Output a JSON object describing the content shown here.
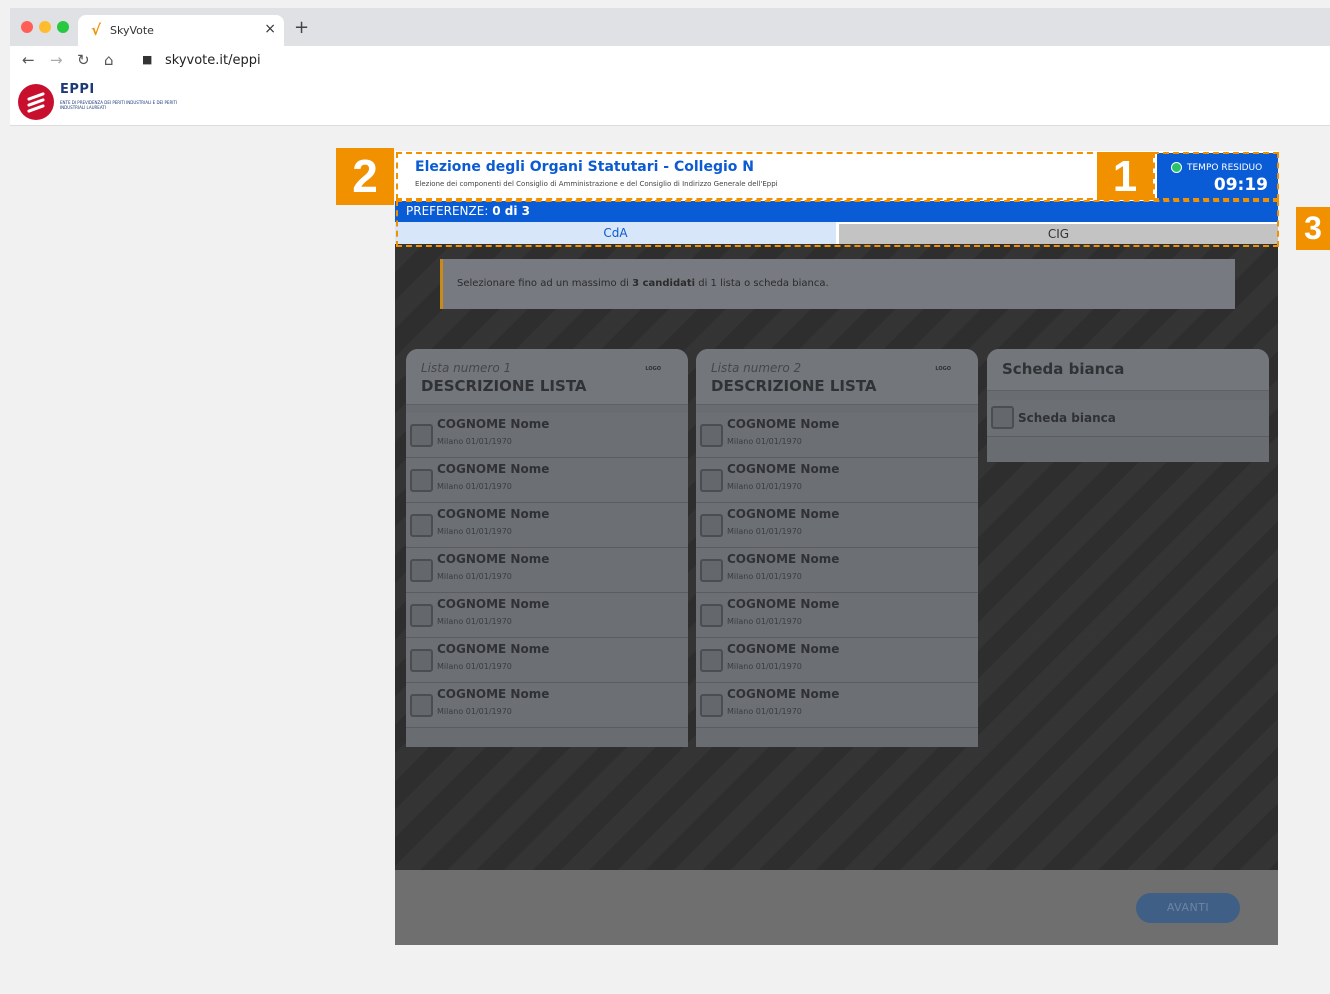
{
  "browser": {
    "tab_title": "SkyVote",
    "tab_close": "×",
    "new_tab": "+",
    "url": "skyvote.it/eppi"
  },
  "site": {
    "logo_name": "EPPI",
    "logo_sub": "ENTE DI PREVIDENZA DEI PERITI INDUSTRIALI E DEI PERITI INDUSTRIALI LAUREATI"
  },
  "header": {
    "title": "Elezione degli Organi Statutari - Collegio N",
    "subtitle": "Elezione dei componenti del Consiglio di Amministrazione e del Consiglio di Indirizzo Generale dell'Eppi"
  },
  "timer": {
    "label": "TEMPO RESIDUO",
    "value": "09:19",
    "status_color": "#29c36a"
  },
  "preferences": {
    "label": "PREFERENZE:",
    "count": "0 di 3"
  },
  "tabs": {
    "cda": "CdA",
    "cig": "CIG"
  },
  "notice": {
    "text_before": "Selezionare fino ad un massimo di ",
    "text_bold": "3 candidati",
    "text_after": " di 1 lista o scheda bianca."
  },
  "lists": [
    {
      "number": "Lista numero 1",
      "description": "DESCRIZIONE LISTA",
      "logo": "LOGO",
      "candidates": [
        {
          "name": "COGNOME Nome",
          "info": "Milano 01/01/1970"
        },
        {
          "name": "COGNOME Nome",
          "info": "Milano 01/01/1970"
        },
        {
          "name": "COGNOME Nome",
          "info": "Milano 01/01/1970"
        },
        {
          "name": "COGNOME Nome",
          "info": "Milano 01/01/1970"
        },
        {
          "name": "COGNOME Nome",
          "info": "Milano 01/01/1970"
        },
        {
          "name": "COGNOME Nome",
          "info": "Milano 01/01/1970"
        },
        {
          "name": "COGNOME Nome",
          "info": "Milano 01/01/1970"
        }
      ]
    },
    {
      "number": "Lista numero 2",
      "description": "DESCRIZIONE LISTA",
      "logo": "LOGO",
      "candidates": [
        {
          "name": "COGNOME Nome",
          "info": "Milano 01/01/1970"
        },
        {
          "name": "COGNOME Nome",
          "info": "Milano 01/01/1970"
        },
        {
          "name": "COGNOME Nome",
          "info": "Milano 01/01/1970"
        },
        {
          "name": "COGNOME Nome",
          "info": "Milano 01/01/1970"
        },
        {
          "name": "COGNOME Nome",
          "info": "Milano 01/01/1970"
        },
        {
          "name": "COGNOME Nome",
          "info": "Milano 01/01/1970"
        },
        {
          "name": "COGNOME Nome",
          "info": "Milano 01/01/1970"
        }
      ]
    }
  ],
  "blank": {
    "title": "Scheda bianca",
    "option": "Scheda bianca"
  },
  "footer": {
    "next_label": "AVANTI"
  },
  "annotations": [
    "1",
    "2",
    "3"
  ],
  "colors": {
    "accent_blue": "#0a5cd6",
    "annotation_orange": "#f29100"
  }
}
